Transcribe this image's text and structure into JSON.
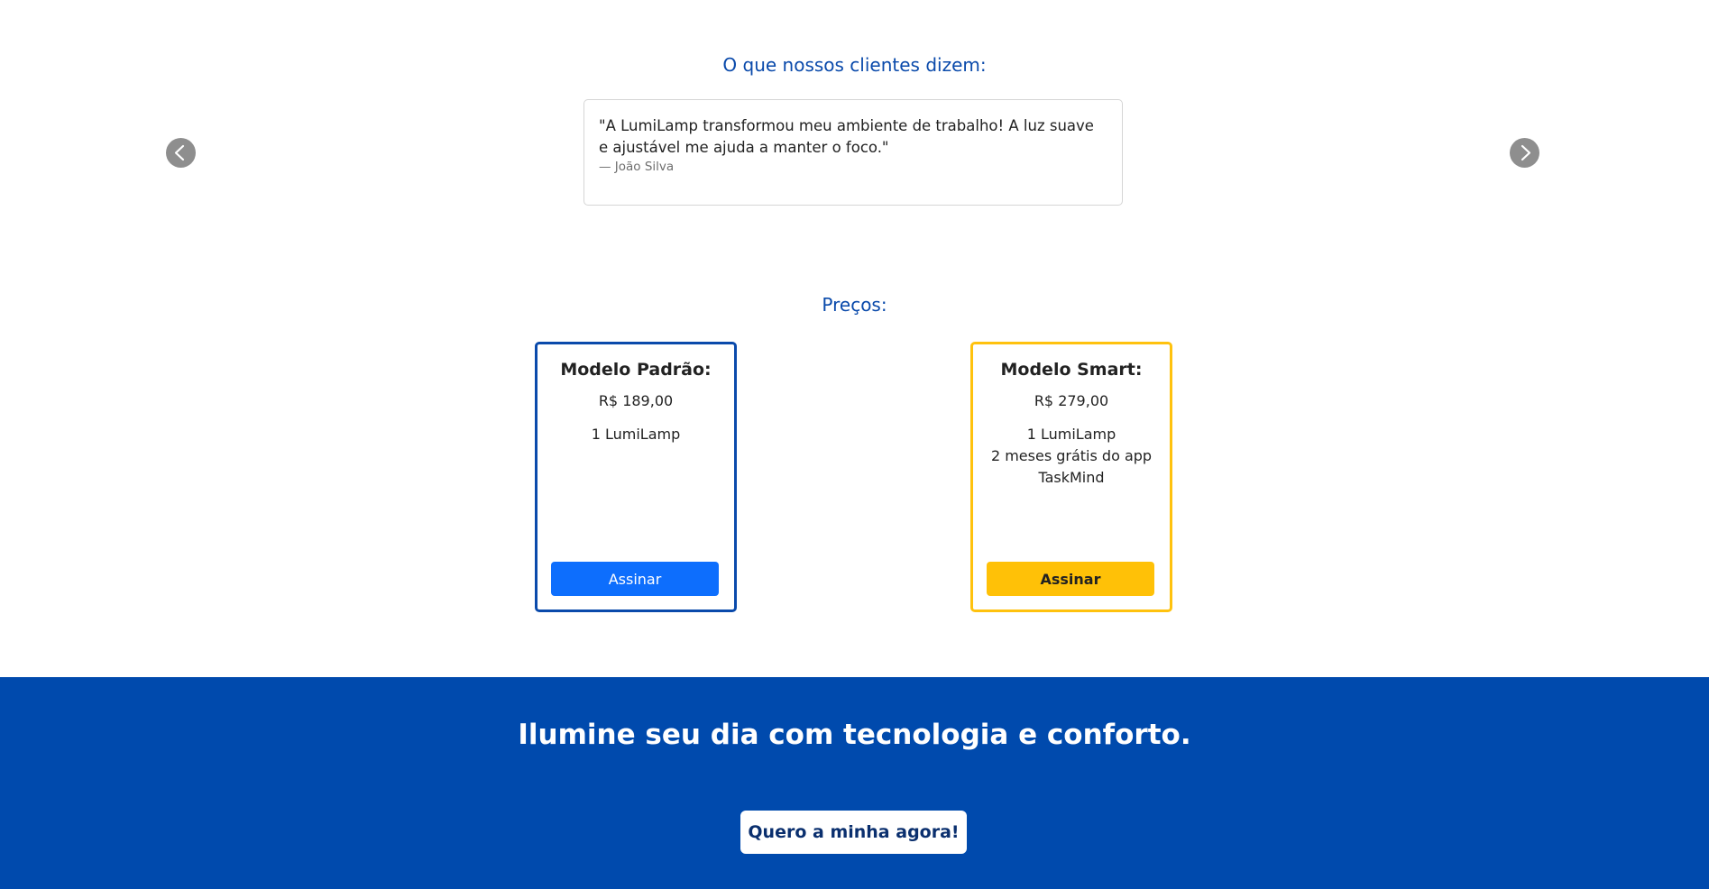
{
  "testimonials": {
    "title": "O que nossos clientes dizem:",
    "quote": "\"A LumiLamp transformou meu ambiente de trabalho! A luz suave e ajustável me ajuda a manter o foco.\"",
    "author": "— João Silva",
    "prev_icon": "chevron-left-icon",
    "next_icon": "chevron-right-icon"
  },
  "pricing": {
    "title": "Preços:",
    "plans": [
      {
        "name": "Modelo Padrão:",
        "price": "R$ 189,00",
        "features": [
          "1 LumiLamp"
        ],
        "button": "Assinar",
        "accent": "#0a4aab",
        "button_color": "#0d6efd"
      },
      {
        "name": "Modelo Smart:",
        "price": "R$ 279,00",
        "features": [
          "1 LumiLamp",
          "2 meses grátis do app TaskMind"
        ],
        "button": "Assinar",
        "accent": "#ffc20e",
        "button_color": "#ffc107"
      }
    ]
  },
  "cta": {
    "headline": "Ilumine seu dia com tecnologia e conforto.",
    "button": "Quero a minha agora!",
    "background": "#004aad"
  }
}
